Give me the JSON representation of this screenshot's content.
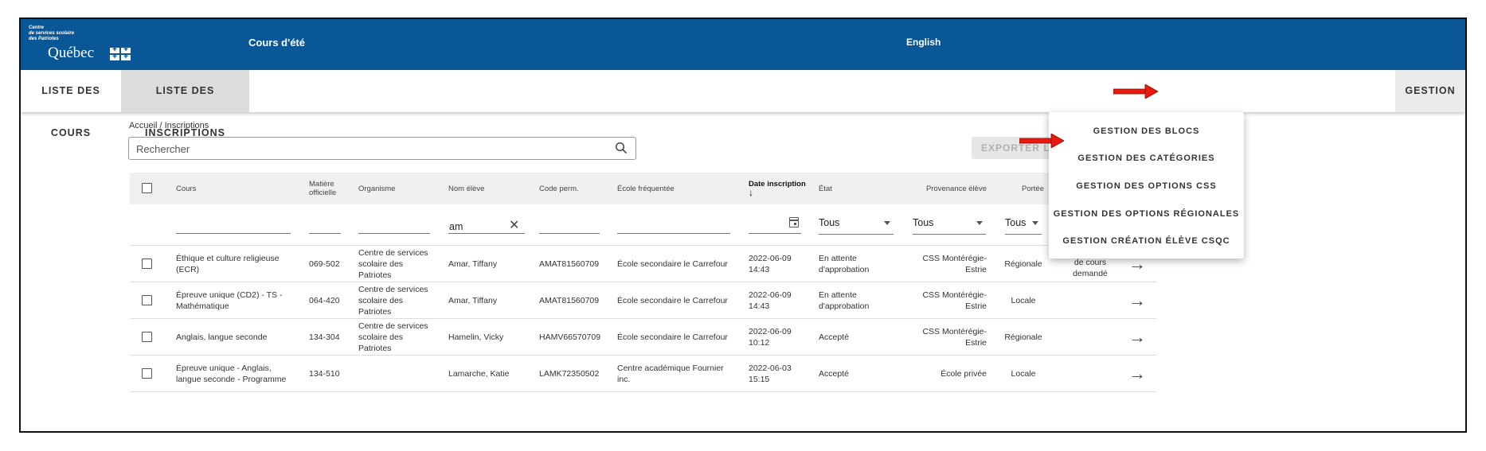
{
  "header": {
    "org_line1": "Centre",
    "org_line2": "de services scolaire",
    "org_line3": "des Patriotes",
    "logo_text": "Québec",
    "app_title": "Cours d'été",
    "language_link": "English",
    "brand_color": "#095797"
  },
  "nav": {
    "tabs": [
      {
        "label": "LISTE DES COURS",
        "active": false
      },
      {
        "label": "LISTE DES INSCRIPTIONS",
        "active": true
      }
    ],
    "gestion_label": "GESTION"
  },
  "gestion_menu": {
    "items": [
      {
        "label": "GESTION DES BLOCS"
      },
      {
        "label": "GESTION DES CATÉGORIES"
      },
      {
        "label": "GESTION DES OPTIONS CSS"
      },
      {
        "label": "GESTION DES OPTIONS RÉGIONALES"
      },
      {
        "label": "GESTION CRÉATION ÉLÈVE CSQC"
      }
    ]
  },
  "annotation_color": "#e8190e",
  "breadcrumb": "Accueil / Inscriptions",
  "search": {
    "placeholder": "Rechercher",
    "value": ""
  },
  "export_label": "EXPORTER LA S",
  "table": {
    "columns": [
      {
        "label": "Cours"
      },
      {
        "label": "Matière officielle"
      },
      {
        "label": "Organisme"
      },
      {
        "label": "Nom élève"
      },
      {
        "label": "Code perm."
      },
      {
        "label": "École fréquentée"
      },
      {
        "label": "Date inscription",
        "sorted": "desc"
      },
      {
        "label": "État"
      },
      {
        "label": "Provenance élève"
      },
      {
        "label": "Portée"
      }
    ],
    "filters": {
      "nom_eleve": "am",
      "etat": "Tous",
      "provenance": "Tous",
      "portee": "Tous"
    },
    "rows": [
      {
        "cours": "Éthique et culture religieuse (ECR)",
        "matiere": "069-502",
        "organisme": "Centre de services scolaire des Patriotes",
        "nom": "Amar, Tiffany",
        "code": "AMAT81560709",
        "ecole": "École secondaire le Carrefour",
        "date": "2022-06-09 14:43",
        "etat": "En attente d'approbation",
        "provenance": "CSS Montérégie-Estrie",
        "portee": "Régionale",
        "extra": "de cours demandé"
      },
      {
        "cours": "Épreuve unique (CD2) - TS - Mathématique",
        "matiere": "064-420",
        "organisme": "Centre de services scolaire des Patriotes",
        "nom": "Amar, Tiffany",
        "code": "AMAT81560709",
        "ecole": "École secondaire le Carrefour",
        "date": "2022-06-09 14:43",
        "etat": "En attente d'approbation",
        "provenance": "CSS Montérégie-Estrie",
        "portee": "Locale",
        "extra": ""
      },
      {
        "cours": "Anglais, langue seconde",
        "matiere": "134-304",
        "organisme": "Centre de services scolaire des Patriotes",
        "nom": "Hamelin, Vicky",
        "code": "HAMV66570709",
        "ecole": "École secondaire le Carrefour",
        "date": "2022-06-09 10:12",
        "etat": "Accepté",
        "provenance": "CSS Montérégie-Estrie",
        "portee": "Régionale",
        "extra": ""
      },
      {
        "cours": "Épreuve unique - Anglais, langue seconde - Programme",
        "matiere": "134-510",
        "organisme": "",
        "nom": "Lamarche, Katie",
        "code": "LAMK72350502",
        "ecole": "Centre académique Fournier inc.",
        "date": "2022-06-03 15:15",
        "etat": "Accepté",
        "provenance": "École privée",
        "portee": "Locale",
        "extra": ""
      }
    ]
  }
}
